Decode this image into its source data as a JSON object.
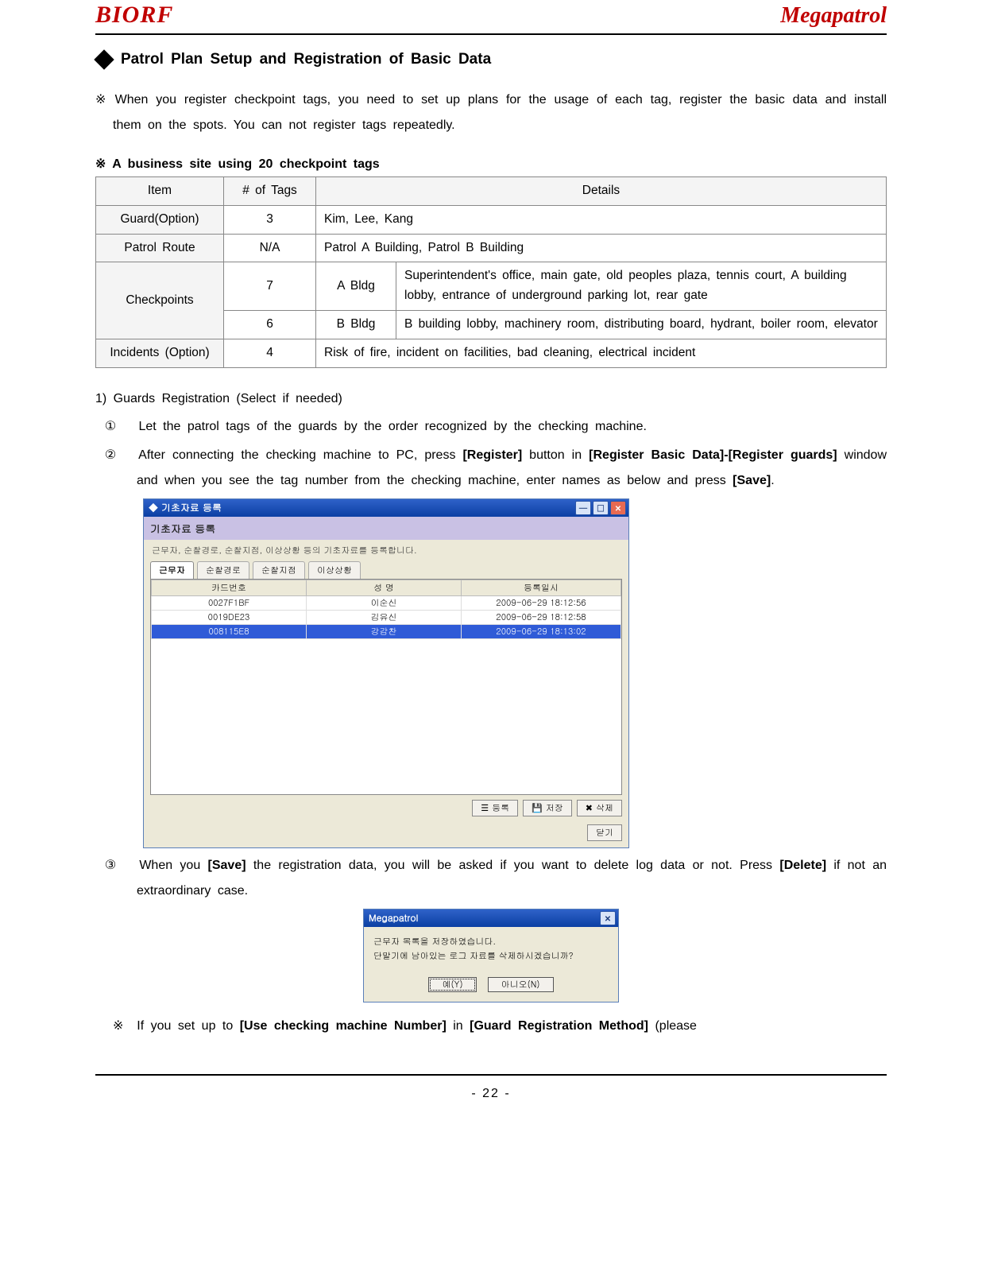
{
  "header": {
    "brand_left": "BIORF",
    "brand_right": "Megapatrol"
  },
  "section": {
    "title": "Patrol  Plan  Setup  and  Registration  of  Basic  Data"
  },
  "intro": "※  When  you  register  checkpoint  tags,  you  need  to  set  up  plans  for  the  usage  of  each  tag,  register  the  basic  data  and  install  them  on  the  spots.  You  can  not  register  tags  repeatedly.",
  "example_head": "※  A  business  site  using  20  checkpoint  tags",
  "table": {
    "headers": {
      "item": "Item",
      "tags": "# of Tags",
      "details": "Details"
    },
    "rows": {
      "guard": {
        "item": "Guard(Option)",
        "tags": "3",
        "details": "Kim,  Lee,  Kang"
      },
      "route": {
        "item": "Patrol Route",
        "tags": "N/A",
        "details": "Patrol  A  Building,  Patrol  B  Building"
      },
      "checkpoints": {
        "item": "Checkpoints"
      },
      "cp_a": {
        "tags": "7",
        "sub": "A  Bldg",
        "details": "Superintendent's  office,  main  gate,  old  peoples  plaza,  tennis  court,  A  building  lobby,  entrance  of  underground  parking  lot,  rear  gate"
      },
      "cp_b": {
        "tags": "6",
        "sub": "B  Bldg",
        "details": "B  building  lobby,  machinery  room,  distributing  board,  hydrant,  boiler  room,  elevator"
      },
      "incidents": {
        "item": "Incidents (Option)",
        "tags": "4",
        "details": "Risk  of  fire,  incident  on  facilities,  bad  cleaning,  electrical  incident"
      }
    }
  },
  "guards_head": "1)  Guards  Registration  (Select  if  needed)",
  "steps": {
    "s1": {
      "num": "①",
      "text": "Let  the  patrol  tags  of  the  guards  by  the  order  recognized  by  the  checking  machine."
    },
    "s2": {
      "num": "②",
      "pre": "After  connecting  the  checking  machine  to  PC,  press  ",
      "b1": "[Register]",
      "mid1": "  button  in  ",
      "b2": "[Register  Basic  Data]-[Register  guards]",
      "mid2": "  window  and  when  you  see  the  tag  number  from  the  checking  machine,  enter  names  as  below  and  press  ",
      "b3": "[Save]",
      "post": "."
    },
    "s3": {
      "num": "③",
      "pre": "When  you  ",
      "b1": "[Save]",
      "mid1": "  the  registration  data,  you  will  be  asked  if  you  want  to  delete  log  data  or  not.  Press  ",
      "b2": "[Delete]",
      "post": "  if  not  an  extraordinary  case."
    }
  },
  "win1": {
    "title": "기초자료 등록",
    "subtitle": "기초자료 등록",
    "desc": "근무자, 순찰경로, 순찰지점, 이상상황 등의 기초자료를 등록합니다.",
    "tabs": {
      "t1": "근무자",
      "t2": "순찰경로",
      "t3": "순찰지점",
      "t4": "이상상황"
    },
    "grid": {
      "headers": {
        "c1": "카드번호",
        "c2": "성 명",
        "c3": "등록일시"
      },
      "rows": [
        {
          "c1": "0027F1BF",
          "c2": "이순신",
          "c3": "2009-06-29 18:12:56"
        },
        {
          "c1": "0019DE23",
          "c2": "김유신",
          "c3": "2009-06-29 18:12:58"
        },
        {
          "c1": "008115E8",
          "c2": "강감찬",
          "c3": "2009-06-29 18:13:02"
        }
      ]
    },
    "buttons": {
      "reg": "등록",
      "save": "저장",
      "del": "삭제",
      "close": "닫기"
    }
  },
  "dlg": {
    "title": "Megapatrol",
    "line1": "근무자 목록을 저장하였습니다.",
    "line2": "단말기에 남아있는 로그 자료를 삭제하시겠습니까?",
    "yes": "예(Y)",
    "no": "아니오(N)"
  },
  "note": {
    "mark": "※",
    "pre": "If  you  set  up  to  ",
    "b1": "[Use  checking  machine  Number]",
    "mid": "  in  ",
    "b2": "[Guard  Registration  Method]",
    "post": "  (please"
  },
  "page_number": "- 22 -"
}
